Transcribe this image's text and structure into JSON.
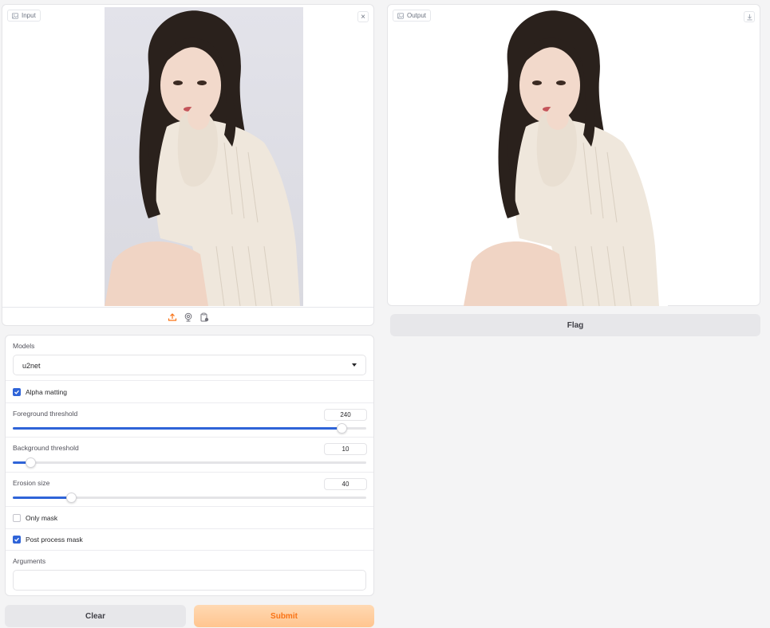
{
  "input_panel": {
    "label": "Input"
  },
  "output_panel": {
    "label": "Output"
  },
  "flag_button": "Flag",
  "settings": {
    "models_label": "Models",
    "models_value": "u2net",
    "alpha_matting": {
      "label": "Alpha matting",
      "checked": true
    },
    "foreground": {
      "label": "Foreground threshold",
      "value": "240",
      "fraction": 0.93
    },
    "background": {
      "label": "Background threshold",
      "value": "10",
      "fraction": 0.05
    },
    "erosion": {
      "label": "Erosion size",
      "value": "40",
      "fraction": 0.165
    },
    "only_mask": {
      "label": "Only mask",
      "checked": false
    },
    "post_process": {
      "label": "Post process mask",
      "checked": true
    },
    "arguments_label": "Arguments",
    "arguments_value": ""
  },
  "clear_button": "Clear",
  "submit_button": "Submit",
  "colors": {
    "accent": "#2f64d8",
    "submit_text": "#f97316",
    "submit_bg": "#ffc58f"
  }
}
